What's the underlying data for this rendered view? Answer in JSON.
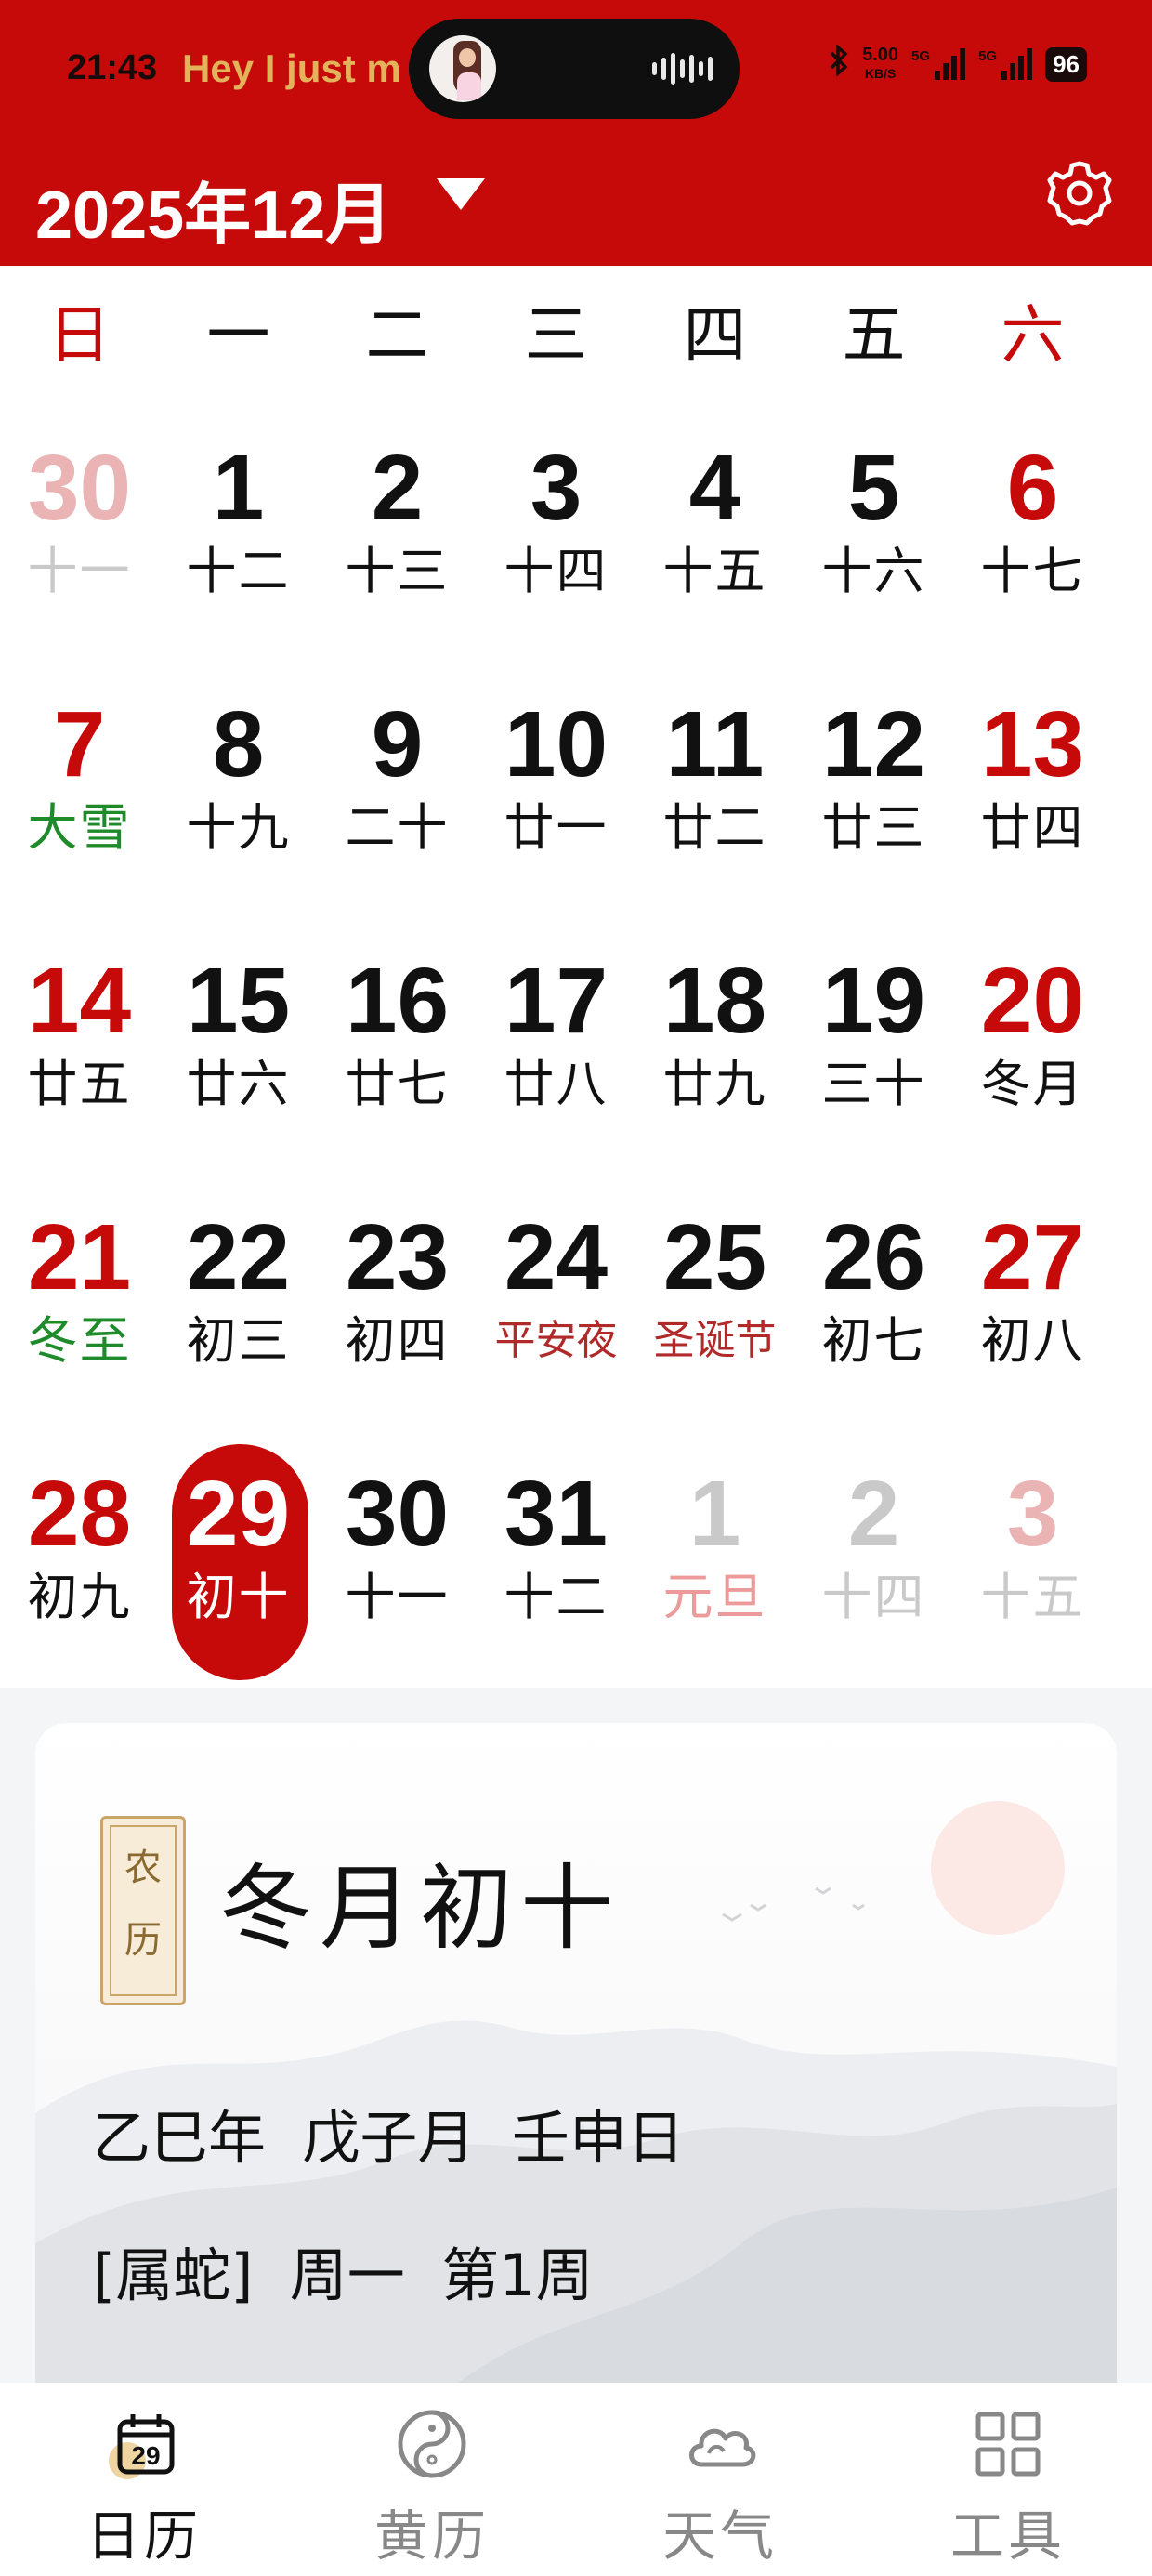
{
  "status_bar": {
    "time": "21:43",
    "ticker": "Hey I just m",
    "net_speed_value": "5.00",
    "net_speed_unit": "KB/S",
    "signal1_label": "5G",
    "signal2_label": "5G",
    "battery": "96"
  },
  "header": {
    "month_title": "2025年12月",
    "settings_icon": "gear-icon"
  },
  "weekdays": [
    "日",
    "一",
    "二",
    "三",
    "四",
    "五",
    "六"
  ],
  "calendar": {
    "weeks": [
      [
        {
          "day": "30",
          "lunar": "十一"
        },
        {
          "day": "1",
          "lunar": "十二"
        },
        {
          "day": "2",
          "lunar": "十三"
        },
        {
          "day": "3",
          "lunar": "十四"
        },
        {
          "day": "4",
          "lunar": "十五"
        },
        {
          "day": "5",
          "lunar": "十六"
        },
        {
          "day": "6",
          "lunar": "十七"
        }
      ],
      [
        {
          "day": "7",
          "lunar": "大雪"
        },
        {
          "day": "8",
          "lunar": "十九"
        },
        {
          "day": "9",
          "lunar": "二十"
        },
        {
          "day": "10",
          "lunar": "廿一"
        },
        {
          "day": "11",
          "lunar": "廿二"
        },
        {
          "day": "12",
          "lunar": "廿三"
        },
        {
          "day": "13",
          "lunar": "廿四"
        }
      ],
      [
        {
          "day": "14",
          "lunar": "廿五"
        },
        {
          "day": "15",
          "lunar": "廿六"
        },
        {
          "day": "16",
          "lunar": "廿七"
        },
        {
          "day": "17",
          "lunar": "廿八"
        },
        {
          "day": "18",
          "lunar": "廿九"
        },
        {
          "day": "19",
          "lunar": "三十"
        },
        {
          "day": "20",
          "lunar": "冬月"
        }
      ],
      [
        {
          "day": "21",
          "lunar": "冬至"
        },
        {
          "day": "22",
          "lunar": "初三"
        },
        {
          "day": "23",
          "lunar": "初四"
        },
        {
          "day": "24",
          "lunar": "平安夜"
        },
        {
          "day": "25",
          "lunar": "圣诞节"
        },
        {
          "day": "26",
          "lunar": "初七"
        },
        {
          "day": "27",
          "lunar": "初八"
        }
      ],
      [
        {
          "day": "28",
          "lunar": "初九"
        },
        {
          "day": "29",
          "lunar": "初十"
        },
        {
          "day": "30",
          "lunar": "十一"
        },
        {
          "day": "31",
          "lunar": "十二"
        },
        {
          "day": "1",
          "lunar": "元旦"
        },
        {
          "day": "2",
          "lunar": "十四"
        },
        {
          "day": "3",
          "lunar": "十五"
        }
      ]
    ]
  },
  "detail": {
    "seal_top": "农",
    "seal_bottom": "历",
    "lunar_date": "冬月初十",
    "ganzhi": "乙巳年  戊子月  壬申日",
    "zodiac_line": "[属蛇]  周一  第1周"
  },
  "tabs": [
    {
      "label": "日历",
      "icon": "calendar-icon",
      "icon_text": "29"
    },
    {
      "label": "黄历",
      "icon": "yin-yang-icon"
    },
    {
      "label": "天气",
      "icon": "cloud-icon"
    },
    {
      "label": "工具",
      "icon": "grid-icon"
    }
  ],
  "colors": {
    "brand_red": "#c60a0a",
    "solar_term_green": "#1e8a2a",
    "festival_red": "#b02a2a"
  }
}
